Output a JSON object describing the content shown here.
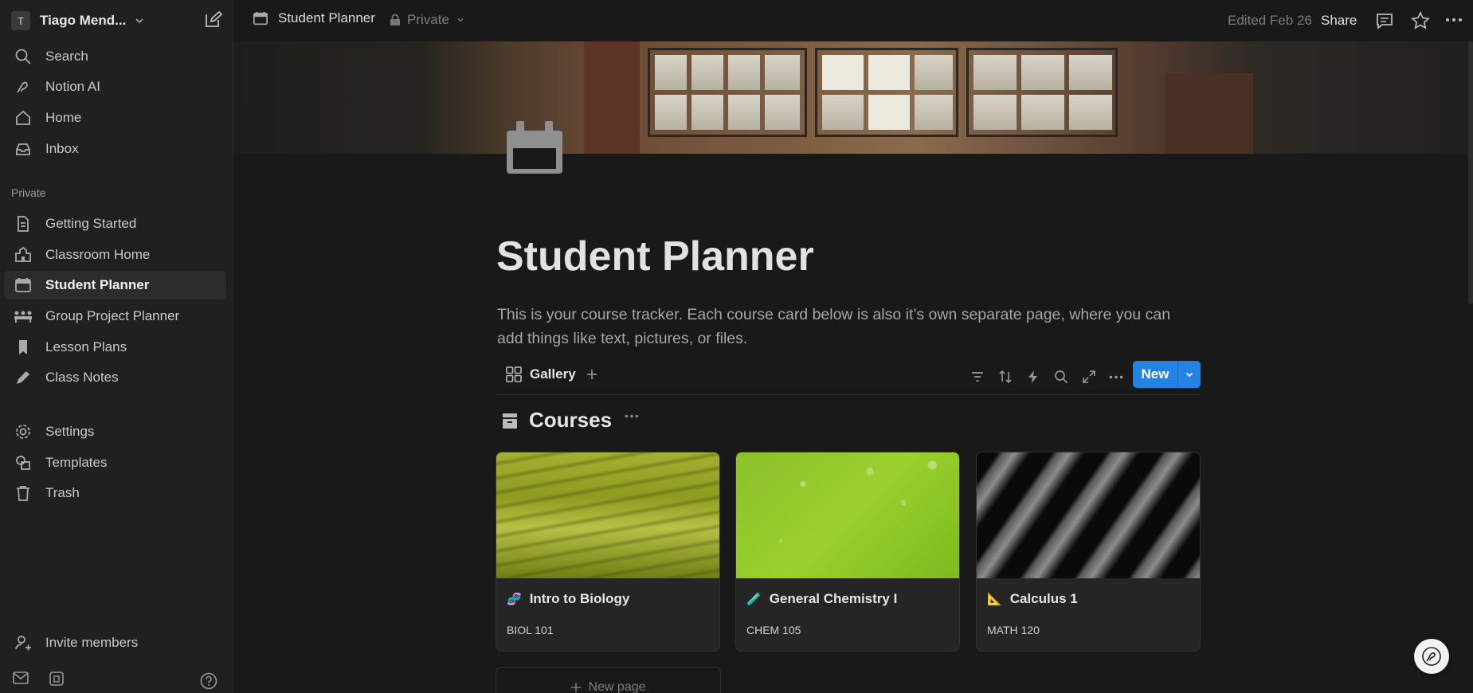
{
  "workspace": {
    "initial": "T",
    "name": "Tiago Mend..."
  },
  "sidebar": {
    "top_items": [
      {
        "label": "Search",
        "icon": "search-icon"
      },
      {
        "label": "Notion AI",
        "icon": "notion-ai-icon"
      },
      {
        "label": "Home",
        "icon": "home-icon"
      },
      {
        "label": "Inbox",
        "icon": "inbox-icon"
      }
    ],
    "section_label": "Private",
    "private_items": [
      {
        "label": "Getting Started",
        "icon": "document-icon"
      },
      {
        "label": "Classroom Home",
        "icon": "school-icon"
      },
      {
        "label": "Student Planner",
        "icon": "calendar-icon",
        "active": true
      },
      {
        "label": "Group Project Planner",
        "icon": "group-icon"
      },
      {
        "label": "Lesson Plans",
        "icon": "bookmark-icon"
      },
      {
        "label": "Class Notes",
        "icon": "pencil-icon"
      }
    ],
    "bottom_items": [
      {
        "label": "Settings",
        "icon": "gear-icon"
      },
      {
        "label": "Templates",
        "icon": "templates-icon"
      },
      {
        "label": "Trash",
        "icon": "trash-icon"
      }
    ],
    "invite_label": "Invite members"
  },
  "topbar": {
    "page_title": "Student Planner",
    "privacy": "Private",
    "edited": "Edited Feb 26",
    "share_label": "Share"
  },
  "page": {
    "title": "Student Planner",
    "description": "This is your course tracker. Each course card below is also it’s own separate page, where you can add things like text, pictures, or files."
  },
  "database": {
    "view_label": "Gallery",
    "new_label": "New",
    "title": "Courses",
    "cards": [
      {
        "name": "Intro to Biology",
        "code": "BIOL 101",
        "emoji": "🧬"
      },
      {
        "name": "General Chemistry I",
        "code": "CHEM 105",
        "emoji": "🧪"
      },
      {
        "name": "Calculus 1",
        "code": "MATH 120",
        "emoji": "📐"
      }
    ],
    "new_page_label": "New page"
  },
  "colors": {
    "accent": "#2383e2",
    "background": "#191919",
    "sidebar": "#202020"
  }
}
